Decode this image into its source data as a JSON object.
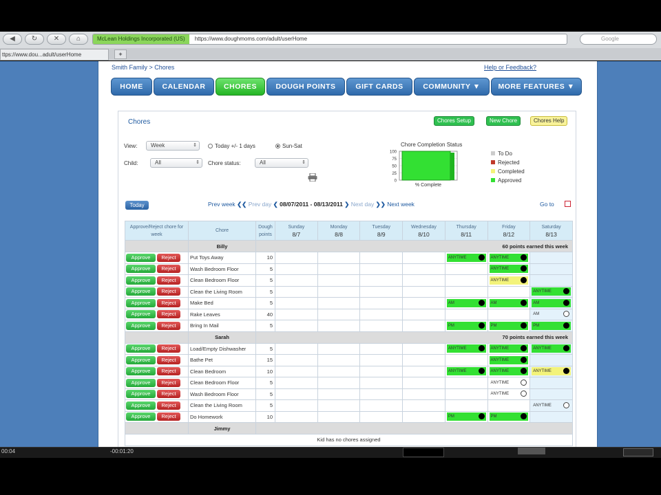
{
  "browser": {
    "ssl_org": "McLean Holdings Incorporated (US)",
    "url": "https://www.doughmoms.com/adult/userHome",
    "search_placeholder": "Google",
    "tab_title": "ttps://www.dou...adult/userHome",
    "new_tab": "+"
  },
  "top": {
    "breadcrumb": "Smith Family > Chores",
    "help": "Help or Feedback?"
  },
  "nav": [
    "HOME",
    "CALENDAR",
    "CHORES",
    "DOUGH POINTS",
    "GIFT CARDS",
    "COMMUNITY ▼",
    "MORE FEATURES ▼"
  ],
  "panel": {
    "title": "Chores",
    "setup_btn": "Chores Setup",
    "new_btn": "New Chore",
    "help_btn": "Chores Help"
  },
  "filters": {
    "view_label": "View:",
    "view_value": "Week",
    "radio_today": "Today +/- 1 days",
    "radio_sunsat": "Sun-Sat",
    "child_label": "Child:",
    "child_value": "All",
    "status_label": "Chore status:",
    "status_value": "All"
  },
  "chart_data": {
    "type": "bar",
    "title": "Chore Completion Status",
    "categories": [
      "% Complete"
    ],
    "series": [
      {
        "name": "Approved",
        "values": [
          100
        ],
        "color": "#33e033"
      }
    ],
    "yticks": [
      "100",
      "75",
      "50",
      "25",
      "0"
    ],
    "ylim": [
      0,
      100
    ],
    "legend": [
      {
        "label": "To Do",
        "color": "#cccccc"
      },
      {
        "label": "Rejected",
        "color": "#c0392b"
      },
      {
        "label": "Completed",
        "color": "#f3f37a"
      },
      {
        "label": "Approved",
        "color": "#33e033"
      }
    ]
  },
  "weeknav": {
    "today": "Today",
    "prev_week": "Prev week",
    "prev_day": "Prev day",
    "range": "08/07/2011 - 08/13/2011",
    "next_day": "Next day",
    "next_week": "Next week",
    "goto": "Go to"
  },
  "grid": {
    "headers": {
      "actions": "Approve/Reject chore for week",
      "chore": "Chore",
      "points": "Dough points"
    },
    "days": [
      {
        "name": "Sunday",
        "date": "8/7"
      },
      {
        "name": "Monday",
        "date": "8/8"
      },
      {
        "name": "Tuesday",
        "date": "8/9"
      },
      {
        "name": "Wednesday",
        "date": "8/10"
      },
      {
        "name": "Thursday",
        "date": "8/11"
      },
      {
        "name": "Friday",
        "date": "8/12"
      },
      {
        "name": "Saturday",
        "date": "8/13"
      }
    ],
    "approve": "Approve",
    "reject": "Reject",
    "kids": [
      {
        "name": "Billy",
        "earned": "60 points earned this week",
        "chores": [
          {
            "chore": "Put Toys Away",
            "points": "10",
            "cells": [
              "",
              "",
              "",
              "",
              "approved|ANYTIME",
              "approved|ANYTIME",
              ""
            ]
          },
          {
            "chore": "Wash Bedroom Floor",
            "points": "5",
            "cells": [
              "",
              "",
              "",
              "",
              "",
              "approved|ANYTIME",
              ""
            ]
          },
          {
            "chore": "Clean Bedroom Floor",
            "points": "5",
            "cells": [
              "",
              "",
              "",
              "",
              "",
              "completed|ANYTIME",
              ""
            ]
          },
          {
            "chore": "Clean the Living Room",
            "points": "5",
            "cells": [
              "",
              "",
              "",
              "",
              "",
              "",
              "approved|ANYTIME"
            ]
          },
          {
            "chore": "Make Bed",
            "points": "5",
            "cells": [
              "",
              "",
              "",
              "",
              "approved|AM",
              "approved|AM",
              "approved|AM"
            ]
          },
          {
            "chore": "Rake Leaves",
            "points": "40",
            "cells": [
              "",
              "",
              "",
              "",
              "",
              "",
              "todo|AM"
            ]
          },
          {
            "chore": "Bring In Mail",
            "points": "5",
            "cells": [
              "",
              "",
              "",
              "",
              "approved|PM",
              "approved|PM",
              "approved|PM"
            ]
          }
        ]
      },
      {
        "name": "Sarah",
        "earned": "70 points earned this week",
        "chores": [
          {
            "chore": "Load/Empty Dishwasher",
            "points": "5",
            "cells": [
              "",
              "",
              "",
              "",
              "approved|ANYTIME",
              "approved|ANYTIME",
              "approved|ANYTIME"
            ]
          },
          {
            "chore": "Bathe Pet",
            "points": "15",
            "cells": [
              "",
              "",
              "",
              "",
              "",
              "approved|ANYTIME",
              ""
            ]
          },
          {
            "chore": "Clean Bedroom",
            "points": "10",
            "cells": [
              "",
              "",
              "",
              "",
              "approved|ANYTIME",
              "approved|ANYTIME",
              "completed|ANYTIME"
            ]
          },
          {
            "chore": "Clean Bedroom Floor",
            "points": "5",
            "cells": [
              "",
              "",
              "",
              "",
              "",
              "todo|ANYTIME",
              ""
            ]
          },
          {
            "chore": "Wash Bedroom Floor",
            "points": "5",
            "cells": [
              "",
              "",
              "",
              "",
              "",
              "todo|ANYTIME",
              ""
            ]
          },
          {
            "chore": "Clean the Living Room",
            "points": "5",
            "cells": [
              "",
              "",
              "",
              "",
              "",
              "",
              "todo|ANYTIME"
            ]
          },
          {
            "chore": "Do Homework",
            "points": "10",
            "cells": [
              "",
              "",
              "",
              "",
              "approved|PM",
              "approved|PM",
              ""
            ]
          }
        ]
      },
      {
        "name": "Jimmy",
        "earned": "",
        "none": "Kid has no chores assigned",
        "chores": []
      }
    ]
  },
  "taskbar": {
    "time_left": "00:04",
    "time_right": "-00:01:20"
  }
}
